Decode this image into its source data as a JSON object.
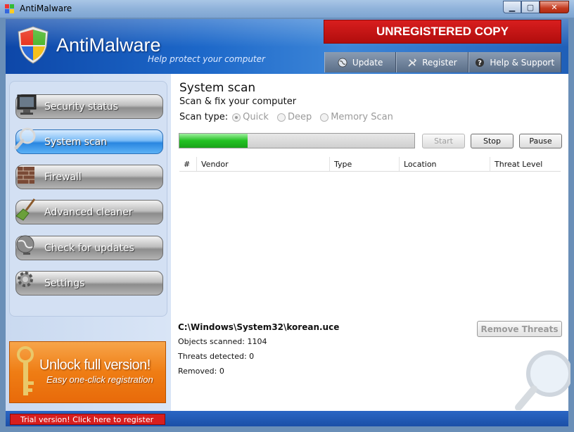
{
  "window": {
    "title": "AntiMalware",
    "minimize": "▁",
    "maximize": "▢",
    "close": "✕"
  },
  "header": {
    "brand": "AntiMalware",
    "tagline": "Help protect your computer",
    "unregistered": "UNREGISTERED COPY",
    "tabs": [
      {
        "label": "Update",
        "icon": "globe-icon"
      },
      {
        "label": "Register",
        "icon": "tools-icon"
      },
      {
        "label": "Help & Support",
        "icon": "help-icon"
      }
    ]
  },
  "sidebar": {
    "items": [
      {
        "label": "Security status",
        "icon": "monitor-icon",
        "active": false
      },
      {
        "label": "System scan",
        "icon": "magnifier-icon",
        "active": true
      },
      {
        "label": "Firewall",
        "icon": "brick-wall-icon",
        "active": false
      },
      {
        "label": "Advanced cleaner",
        "icon": "broom-icon",
        "active": false
      },
      {
        "label": "Check for updates",
        "icon": "globe-icon",
        "active": false
      },
      {
        "label": "Settings",
        "icon": "gear-icon",
        "active": false
      }
    ],
    "unlock_title": "Unlock full version!",
    "unlock_subtitle": "Easy one-click registration"
  },
  "main": {
    "title": "System scan",
    "subtitle": "Scan & fix your computer",
    "scan_type_label": "Scan type:",
    "scan_types": [
      {
        "label": "Quick",
        "selected": true
      },
      {
        "label": "Deep",
        "selected": false
      },
      {
        "label": "Memory Scan",
        "selected": false
      }
    ],
    "progress_fraction": 0.29,
    "buttons": {
      "start": "Start",
      "stop": "Stop",
      "pause": "Pause"
    },
    "columns": [
      "#",
      "Vendor",
      "Type",
      "Location",
      "Threat Level"
    ],
    "current_file": "C:\\Windows\\System32\\korean.uce",
    "objects_scanned": "Objects scanned: 1104",
    "threats_detected": "Threats detected: 0",
    "removed": "Removed: 0",
    "remove_button": "Remove Threats"
  },
  "statusbar": {
    "trial_text": "Trial version! Click here to register"
  },
  "colors": {
    "accent": "#1d68c9",
    "warning": "#d81e1e",
    "unlock": "#ef7d14",
    "progress": "#22c122"
  }
}
